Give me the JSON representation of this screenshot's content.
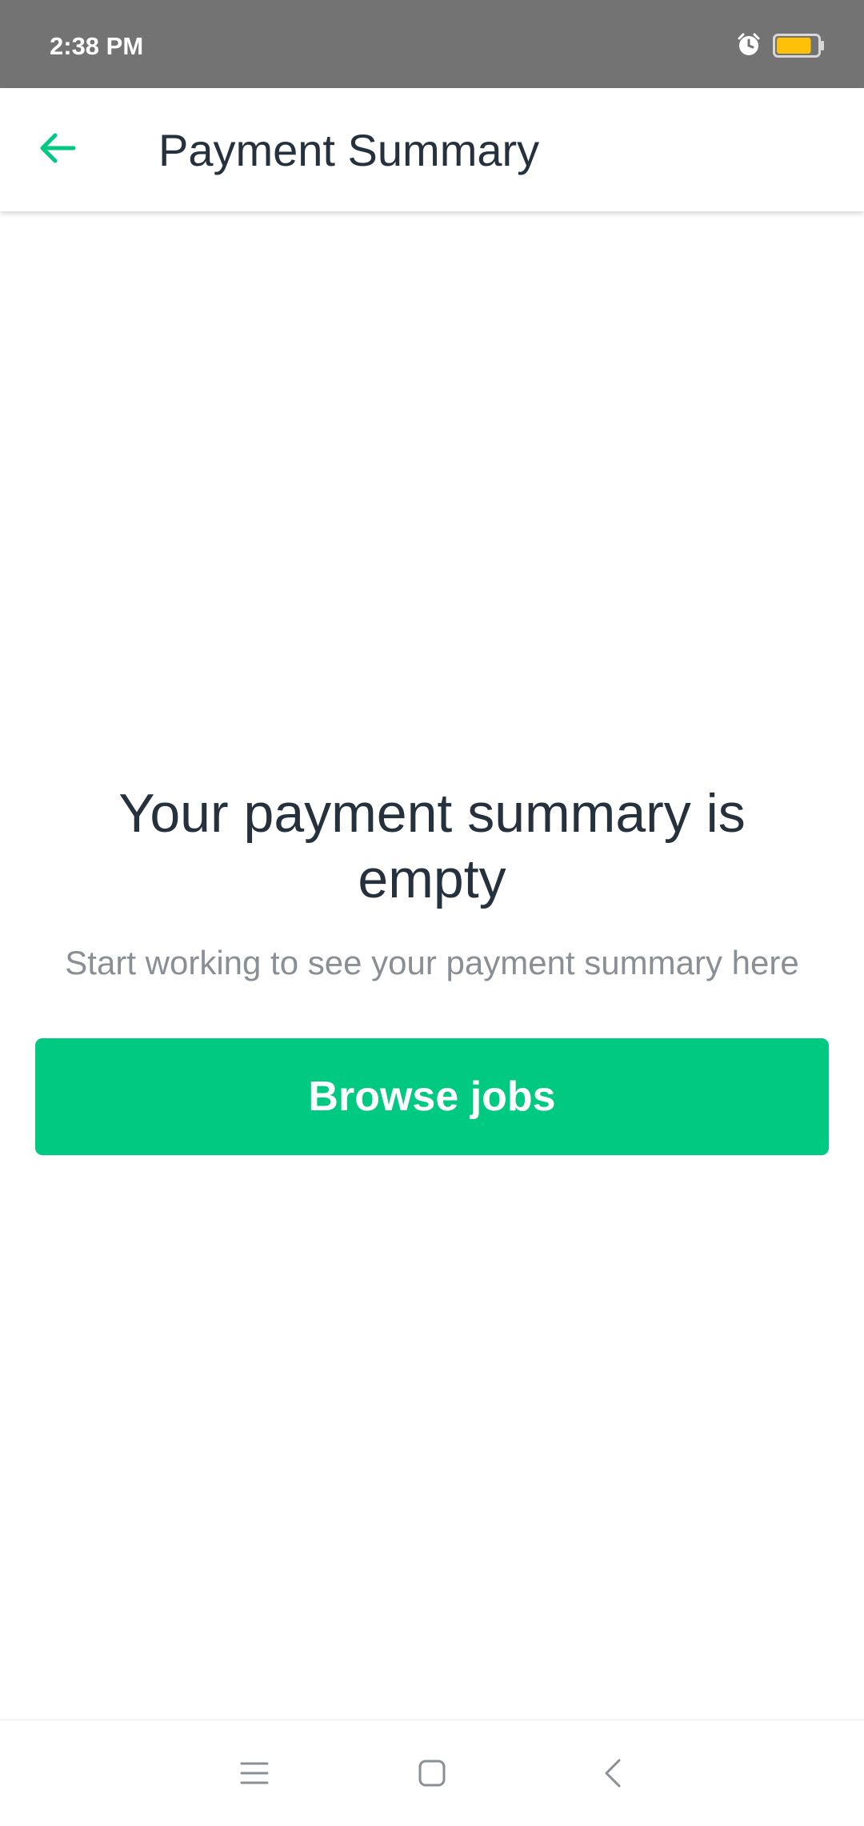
{
  "status_bar": {
    "time": "2:38 PM",
    "icons": [
      "alarm-icon",
      "battery-icon"
    ],
    "battery_level": 0.85,
    "battery_color": "#ffc107"
  },
  "app_bar": {
    "back_icon": "arrow-left-icon",
    "title": "Payment Summary"
  },
  "empty_state": {
    "title": "Your payment summary is empty",
    "subtitle": "Start working to see your payment summary here",
    "button_label": "Browse jobs"
  },
  "nav_bar": {
    "buttons": [
      "menu-icon",
      "home-icon",
      "back-icon"
    ]
  },
  "colors": {
    "accent": "#00c982",
    "title_text": "#25313d",
    "secondary_text": "#8a8f96",
    "status_bar_bg": "#737373"
  }
}
